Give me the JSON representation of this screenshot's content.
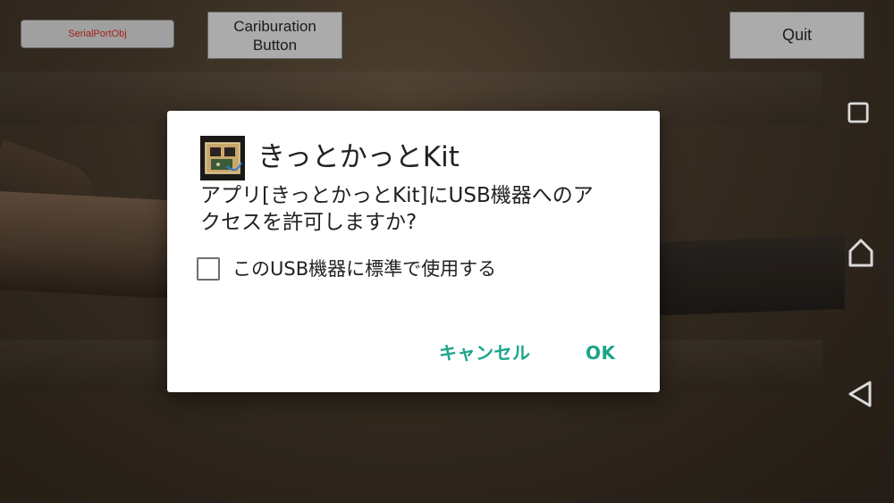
{
  "top_buttons": {
    "serial_label": "SerialPortObj",
    "calibration_label_line1": "Cariburation",
    "calibration_label_line2": "Button",
    "quit_label": "Quit"
  },
  "dialog": {
    "app_name": "きっとかっとKit",
    "message_line1": "アプリ[きっとかっとKit]にUSB機器へのア",
    "message_line2": "クセスを許可しますか?",
    "checkbox_label": "このUSB機器に標準で使用する",
    "checkbox_checked": false,
    "cancel_label": "キャンセル",
    "ok_label": "OK",
    "accent_color": "#1aa58a"
  },
  "nav_bar": {
    "icons": [
      "recent-apps-icon",
      "home-icon",
      "back-icon"
    ]
  }
}
